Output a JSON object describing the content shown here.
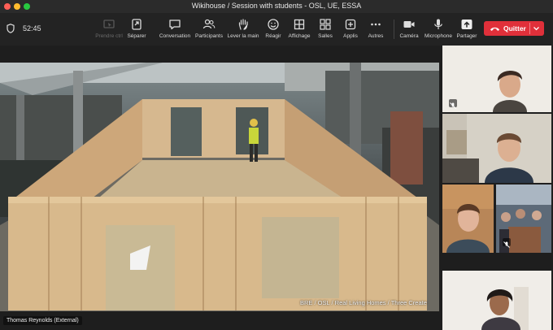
{
  "window": {
    "title": "Wikihouse / Session with students - OSL, UE, ESSA"
  },
  "meeting": {
    "timer": "52:45"
  },
  "toolbar": {
    "items": [
      {
        "label": "Prendre ctrl",
        "icon": "remote-control-icon",
        "enabled": false
      },
      {
        "label": "Séparer",
        "icon": "split-icon",
        "enabled": true
      },
      {
        "label": "Conversation",
        "icon": "chat-icon",
        "enabled": true
      },
      {
        "label": "Participants",
        "icon": "participants-icon",
        "enabled": true
      },
      {
        "label": "Lever la main",
        "icon": "raise-hand-icon",
        "enabled": true
      },
      {
        "label": "Réagir",
        "icon": "smiley-icon",
        "enabled": true
      },
      {
        "label": "Affichage",
        "icon": "grid-icon",
        "enabled": true
      },
      {
        "label": "Salles",
        "icon": "rooms-icon",
        "enabled": true
      },
      {
        "label": "Applis",
        "icon": "apps-icon",
        "enabled": true
      },
      {
        "label": "Autres",
        "icon": "more-icon",
        "enabled": true
      },
      {
        "label": "Caméra",
        "icon": "camera-icon",
        "enabled": true
      },
      {
        "label": "Microphone",
        "icon": "microphone-icon",
        "enabled": true
      },
      {
        "label": "Partager",
        "icon": "share-icon",
        "enabled": true
      }
    ],
    "quit_label": "Quitter"
  },
  "main_video": {
    "watermark": "BRE / OSL / Real Living Homes / Three Create",
    "speaker_name": "Thomas Reynolds (External)"
  },
  "colors": {
    "quit": "#e0303a",
    "toolbar": "#232323",
    "background": "#1e1e1e"
  }
}
